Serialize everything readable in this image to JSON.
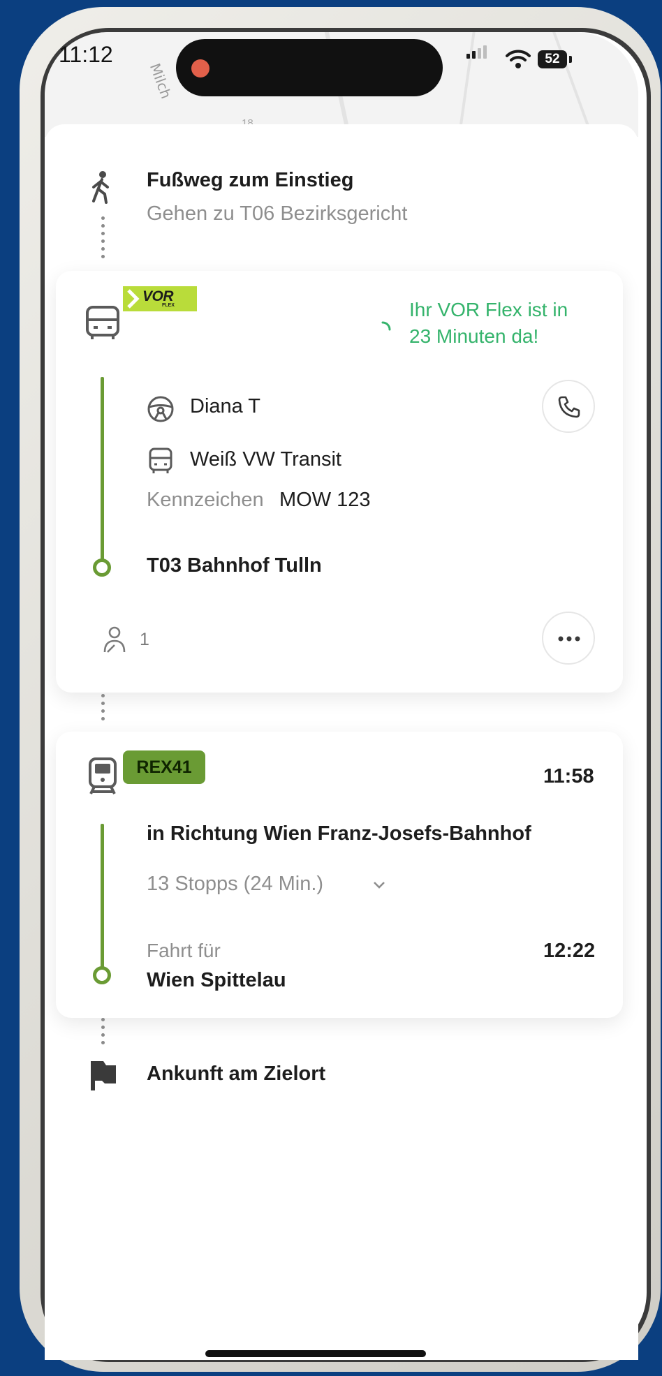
{
  "status_bar": {
    "time": "11:12",
    "battery": "52"
  },
  "map": {
    "street_label": "Milch",
    "house_number": "18"
  },
  "walk": {
    "title": "Fußweg zum Einstieg",
    "subtitle": "Gehen zu T06 Bezirksgericht"
  },
  "vor_flex": {
    "logo_text": "VOR",
    "logo_subtext": "FLEX",
    "eta_line1": "Ihr VOR Flex ist in",
    "eta_line2": "23 Minuten da!",
    "driver": "Diana T",
    "vehicle": "Weiß VW Transit",
    "plate_label": "Kennzeichen",
    "plate_value": "MOW 123",
    "destination": "T03 Bahnhof Tulln",
    "passengers": "1"
  },
  "train": {
    "line": "REX41",
    "departure": "11:58",
    "direction": "in Richtung Wien Franz-Josefs-Bahnhof",
    "stops": "13 Stopps (24 Min.)",
    "ride_label": "Fahrt für",
    "arrival": "12:22",
    "destination": "Wien Spittelau"
  },
  "arrival": {
    "title": "Ankunft am Zielort"
  },
  "colors": {
    "accent_green": "#6a9b34",
    "eta_green": "#34b36b",
    "background_blue": "#0b3f80",
    "vor_lime": "#b9dc3a"
  },
  "icons": [
    "walking-person-icon",
    "minibus-icon",
    "steering-wheel-icon",
    "phone-icon",
    "passenger-icon",
    "more-icon",
    "train-icon",
    "chevron-down-icon",
    "flag-icon",
    "spinner-icon",
    "wifi-icon",
    "signal-icon"
  ]
}
